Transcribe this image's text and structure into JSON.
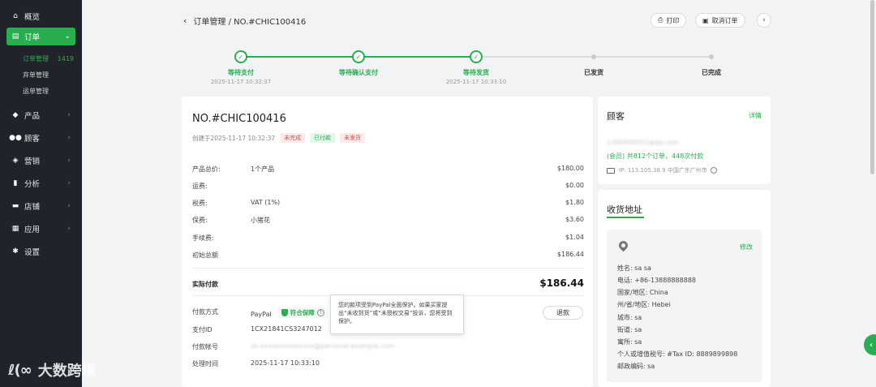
{
  "sidebar": {
    "items": [
      {
        "label": "概览",
        "icon": "home-icon"
      },
      {
        "label": "订单",
        "icon": "order-icon"
      },
      {
        "label": "产品",
        "icon": "product-icon"
      },
      {
        "label": "顾客",
        "icon": "users-icon"
      },
      {
        "label": "营销",
        "icon": "tag-icon"
      },
      {
        "label": "分析",
        "icon": "bar-chart-icon"
      },
      {
        "label": "店铺",
        "icon": "store-icon"
      },
      {
        "label": "应用",
        "icon": "apps-icon"
      },
      {
        "label": "设置",
        "icon": "gear-icon"
      }
    ],
    "subitems": [
      {
        "label": "订单管理",
        "count": "1419"
      },
      {
        "label": "弃单管理"
      },
      {
        "label": "运单管理"
      }
    ],
    "watermark": "大数跨境",
    "watermark_logo": "ℓ(∞"
  },
  "header": {
    "breadcrumb": "订单管理 / NO.#CHIC100416",
    "print_label": "打印",
    "cancel_label": "取消订单"
  },
  "steps": [
    {
      "label": "等待支付",
      "time": "2025-11-17 10:32:37",
      "done": true
    },
    {
      "label": "等待确认支付",
      "time": "",
      "done": true
    },
    {
      "label": "等待发货",
      "time": "2025-11-17 10:33:10",
      "done": true
    },
    {
      "label": "已发货",
      "time": "",
      "done": false
    },
    {
      "label": "已完成",
      "time": "",
      "done": false
    }
  ],
  "order": {
    "number": "NO.#CHIC100416",
    "created": "创建于2025-11-17 10:32:37",
    "tags": [
      "未完成",
      "已付款",
      "未发货"
    ],
    "lines": [
      {
        "key": "产品总价:",
        "value": "1个产品",
        "amount": "$180.00"
      },
      {
        "key": "运费:",
        "value": "",
        "amount": "$0.00"
      },
      {
        "key": "税费:",
        "value": "VAT (1%)",
        "amount": "$1.80"
      },
      {
        "key": "保费:",
        "value": "小猪花",
        "amount": "$3.60"
      },
      {
        "key": "手续费:",
        "value": "",
        "amount": "$1.04"
      },
      {
        "key": "初始总额",
        "value": "",
        "amount": "$186.44"
      }
    ],
    "paid_label": "实际付款",
    "paid_amount": "$186.44",
    "payment": {
      "method_key": "付款方式",
      "method": "PayPal",
      "protect_label": "符合保障",
      "id_key": "支付ID",
      "id": "1CX21841CS3247012",
      "account_key": "付款帐号",
      "account": "sb-xxxxxxxxxxxxxx@personal.example.com",
      "time_key": "处理时间",
      "time": "2025-11-17 10:33:10",
      "refund_label": "退款"
    },
    "tooltip": "您的款项受到PayPal全面保护。如果买家提出“未收到货”或“未授权交易”投诉，您将受到保护。"
  },
  "customer": {
    "title": "顾客",
    "detail_link": "详情",
    "email": "1306490052@qq.com",
    "stats": "(会员) 共812个订单，448次付款",
    "ip": "IP: 113.105.38.9 中国广东广州市"
  },
  "address": {
    "title": "收货地址",
    "edit_link": "修改",
    "lines": [
      "姓名: sa sa",
      "电话: +86-13888888888",
      "国家/地区: China",
      "州/省/地区: Hebei",
      "城市: sa",
      "街道: sa",
      "寓所: sa",
      "个人或增值税号: #Tax ID: 8889899898",
      "邮政编码: sa"
    ]
  },
  "colors": {
    "accent": "#27ae4f",
    "sidebar": "#20232a"
  }
}
